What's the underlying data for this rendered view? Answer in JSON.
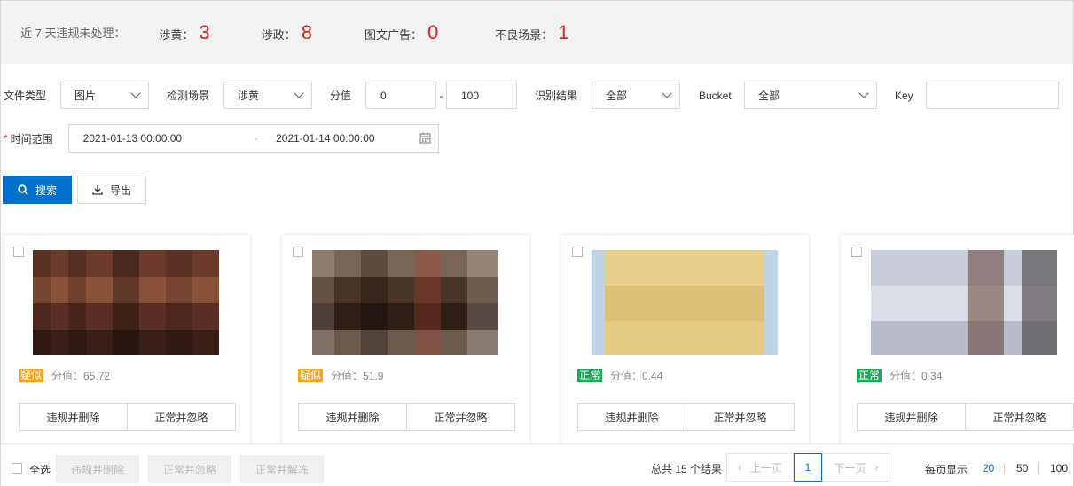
{
  "summary": {
    "label": "近 7 天违规未处理：",
    "items": [
      {
        "label": "涉黄：",
        "count": "3"
      },
      {
        "label": "涉政：",
        "count": "8"
      },
      {
        "label": "图文广告：",
        "count": "0"
      },
      {
        "label": "不良场景：",
        "count": "1"
      }
    ]
  },
  "filters": {
    "file_type_label": "文件类型",
    "file_type_value": "图片",
    "scene_label": "检测场景",
    "scene_value": "涉黄",
    "score_label": "分值",
    "score_min": "0",
    "score_sep": "-",
    "score_max": "100",
    "result_label": "识别结果",
    "result_value": "全部",
    "bucket_label": "Bucket",
    "bucket_value": "全部",
    "key_label": "Key",
    "key_value": "",
    "time_required_mark": "*",
    "time_label": "时间范围",
    "time_start": "2021-01-13 00:00:00",
    "time_sep": "-",
    "time_end": "2021-01-14 00:00:00"
  },
  "actions": {
    "search_label": "搜索",
    "export_label": "导出"
  },
  "cards": [
    {
      "tag": "疑似",
      "tag_color": "#f5a623",
      "score_label": "分值：",
      "score": "65.72",
      "btn_delete": "违规并删除",
      "btn_ignore": "正常并忽略"
    },
    {
      "tag": "疑似",
      "tag_color": "#f5a623",
      "score_label": "分值：",
      "score": "51.9",
      "btn_delete": "违规并删除",
      "btn_ignore": "正常并忽略"
    },
    {
      "tag": "正常",
      "tag_color": "#1aaa55",
      "score_label": "分值：",
      "score": "0.44",
      "btn_delete": "违规并删除",
      "btn_ignore": "正常并忽略"
    },
    {
      "tag": "正常",
      "tag_color": "#1aaa55",
      "score_label": "分值：",
      "score": "0.34",
      "btn_delete": "违规并删除",
      "btn_ignore": "正常并忽略"
    }
  ],
  "bottom": {
    "select_all": "全选",
    "batch_delete": "违规并删除",
    "batch_ignore": "正常并忽略",
    "batch_unfreeze": "正常并解冻",
    "total": "总共 15 个结果",
    "prev": "上一页",
    "page": "1",
    "next": "下一页",
    "page_size_label": "每页显示",
    "page_sizes": [
      "20",
      "50",
      "100"
    ],
    "active_page_size": "20"
  },
  "colors": {
    "primary": "#0070cc",
    "danger_count": "#d9261c",
    "suspect_tag": "#f5a623",
    "normal_tag": "#1aaa55"
  }
}
